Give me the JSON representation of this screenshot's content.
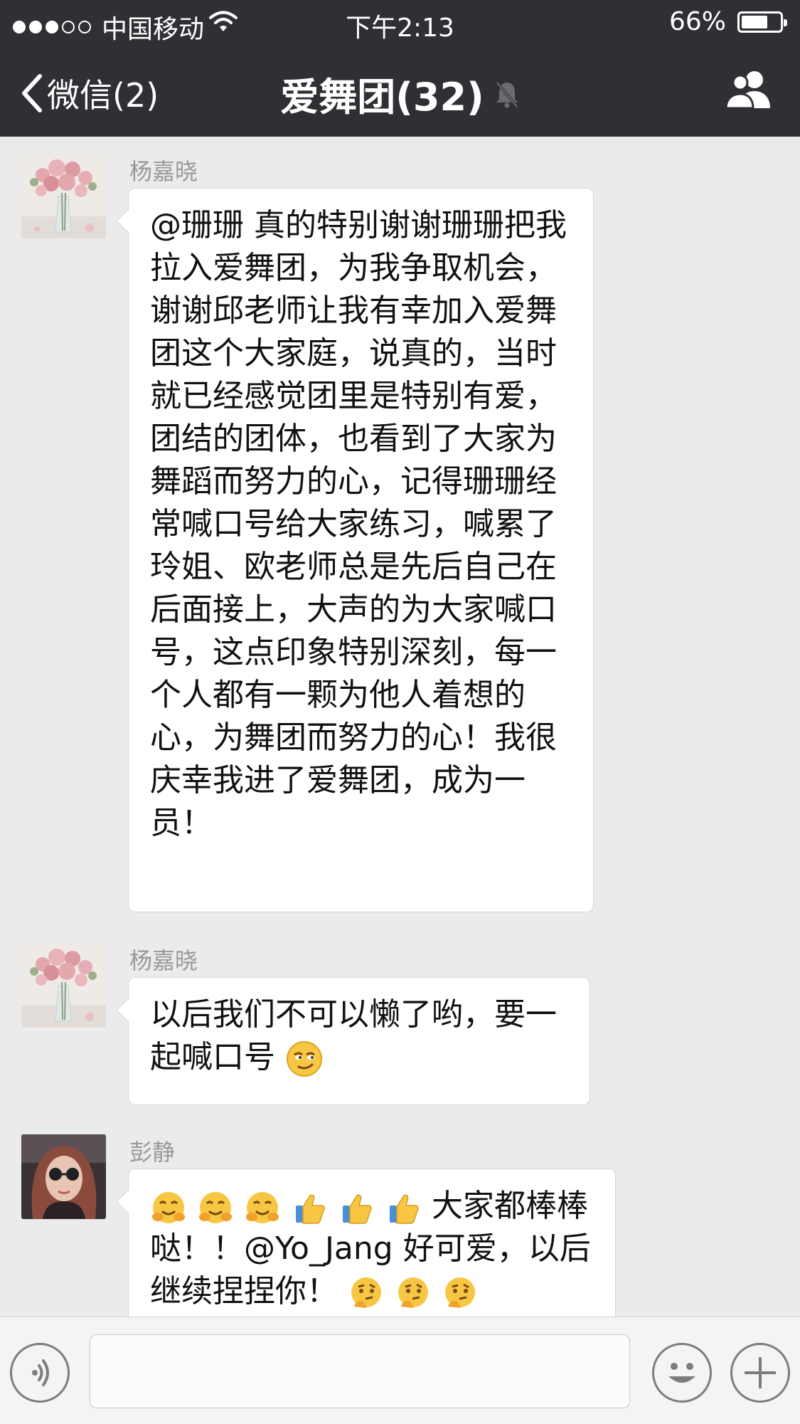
{
  "status_bar": {
    "carrier": "中国移动",
    "time": "下午2:13",
    "battery": "66%",
    "battery_level": 0.66,
    "signal_bars": 3,
    "signal_total": 5
  },
  "nav": {
    "back_label": "微信(2)",
    "title": "爱舞团(32)",
    "icons": [
      "back-chevron-icon",
      "mute-bell-icon",
      "group-members-icon"
    ]
  },
  "messages": [
    {
      "sender": "杨嘉晓",
      "avatar": "roses-vase",
      "text": "@珊珊 真的特别谢谢珊珊把我拉入爱舞团，为我争取机会，谢谢邱老师让我有幸加入爱舞团这个大家庭，说真的，当时就已经感觉团里是特别有爱，团结的团体，也看到了大家为舞蹈而努力的心，记得珊珊经常喊口号给大家练习，喊累了玲姐、欧老师总是先后自己在后面接上，大声的为大家喊口号，这点印象特别深刻，每一个人都有一颗为他人着想的心，为舞团而努力的心！我很庆幸我进了爱舞团，成为一员！"
    },
    {
      "sender": "杨嘉晓",
      "avatar": "roses-vase",
      "text": "以后我们不可以懒了哟，要一起喊口号",
      "emoji": "smirk-face"
    },
    {
      "sender": "彭静",
      "avatar": "woman-sunglasses",
      "emoji_prefix": [
        "hug",
        "hug",
        "hug",
        "thumbs-up",
        "thumbs-up",
        "thumbs-up"
      ],
      "text": "大家都棒棒哒！！@Yo_Jang 好可爱，以后继续捏捏你！",
      "emoji_suffix": [
        "thinking",
        "thinking",
        "thinking"
      ]
    }
  ],
  "input_bar": {
    "value": "",
    "icons": [
      "voice-icon",
      "emoji-icon",
      "plus-icon"
    ]
  },
  "colors": {
    "nav_bg": "#2f3034",
    "chat_bg": "#ebebeb",
    "bubble_bg": "#ffffff",
    "sender_name": "#999999"
  }
}
